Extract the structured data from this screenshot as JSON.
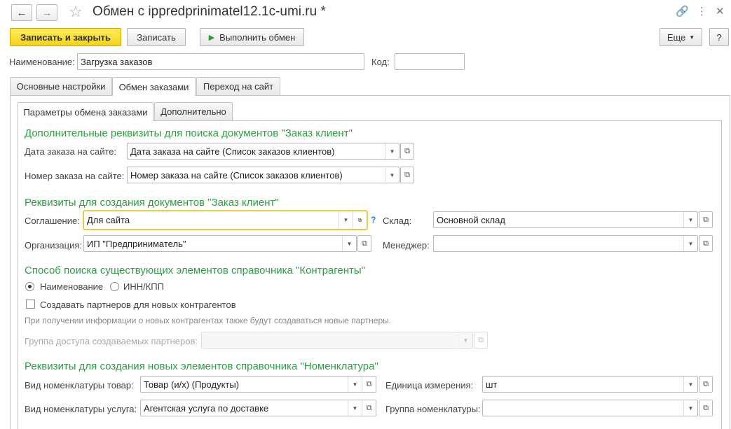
{
  "window": {
    "title": "Обмен с ippredprinimatel12.1c-umi.ru *"
  },
  "toolbar": {
    "save_close": "Записать и закрыть",
    "save": "Записать",
    "run_exchange": "Выполнить обмен",
    "more": "Еще",
    "help": "?"
  },
  "header": {
    "name_label": "Наименование:",
    "name_value": "Загрузка заказов",
    "code_label": "Код:",
    "code_value": ""
  },
  "tabs": [
    {
      "label": "Основные настройки"
    },
    {
      "label": "Обмен заказами"
    },
    {
      "label": "Переход на сайт"
    }
  ],
  "subtabs": [
    {
      "label": "Параметры обмена заказами"
    },
    {
      "label": "Дополнительно"
    }
  ],
  "sections": {
    "search_props": {
      "title": "Дополнительные реквизиты для поиска документов \"Заказ клиент\"",
      "order_date_label": "Дата заказа на сайте:",
      "order_date_value": "Дата заказа на сайте (Список заказов клиентов)",
      "order_number_label": "Номер заказа на сайте:",
      "order_number_value": "Номер заказа на сайте (Список заказов клиентов)"
    },
    "create_props": {
      "title": "Реквизиты для создания документов \"Заказ клиент\"",
      "agreement_label": "Соглашение:",
      "agreement_value": "Для сайта",
      "organization_label": "Организация:",
      "organization_value": "ИП \"Предприниматель\"",
      "warehouse_label": "Склад:",
      "warehouse_value": "Основной склад",
      "manager_label": "Менеджер:",
      "manager_value": "",
      "help": "?"
    },
    "counterparty": {
      "title": "Способ поиска существующих элементов справочника \"Контрагенты\"",
      "radio_name": "Наименование",
      "radio_inn": "ИНН/КПП",
      "checkbox_label": "Создавать партнеров для новых контрагентов",
      "hint": "При получении информации о новых контрагентах также будут создаваться новые партнеры.",
      "access_group_label": "Группа доступа создаваемых партнеров:",
      "access_group_value": ""
    },
    "nomenclature": {
      "title": "Реквизиты для создания новых элементов справочника \"Номенклатура\"",
      "goods_kind_label": "Вид номенклатуры товар:",
      "goods_kind_value": "Товар (и/х) (Продукты)",
      "service_kind_label": "Вид номенклатуры услуга:",
      "service_kind_value": "Агентская услуга по доставке",
      "unit_label": "Единица измерения:",
      "unit_value": "шт",
      "group_label": "Группа номенклатуры:",
      "group_value": ""
    }
  }
}
